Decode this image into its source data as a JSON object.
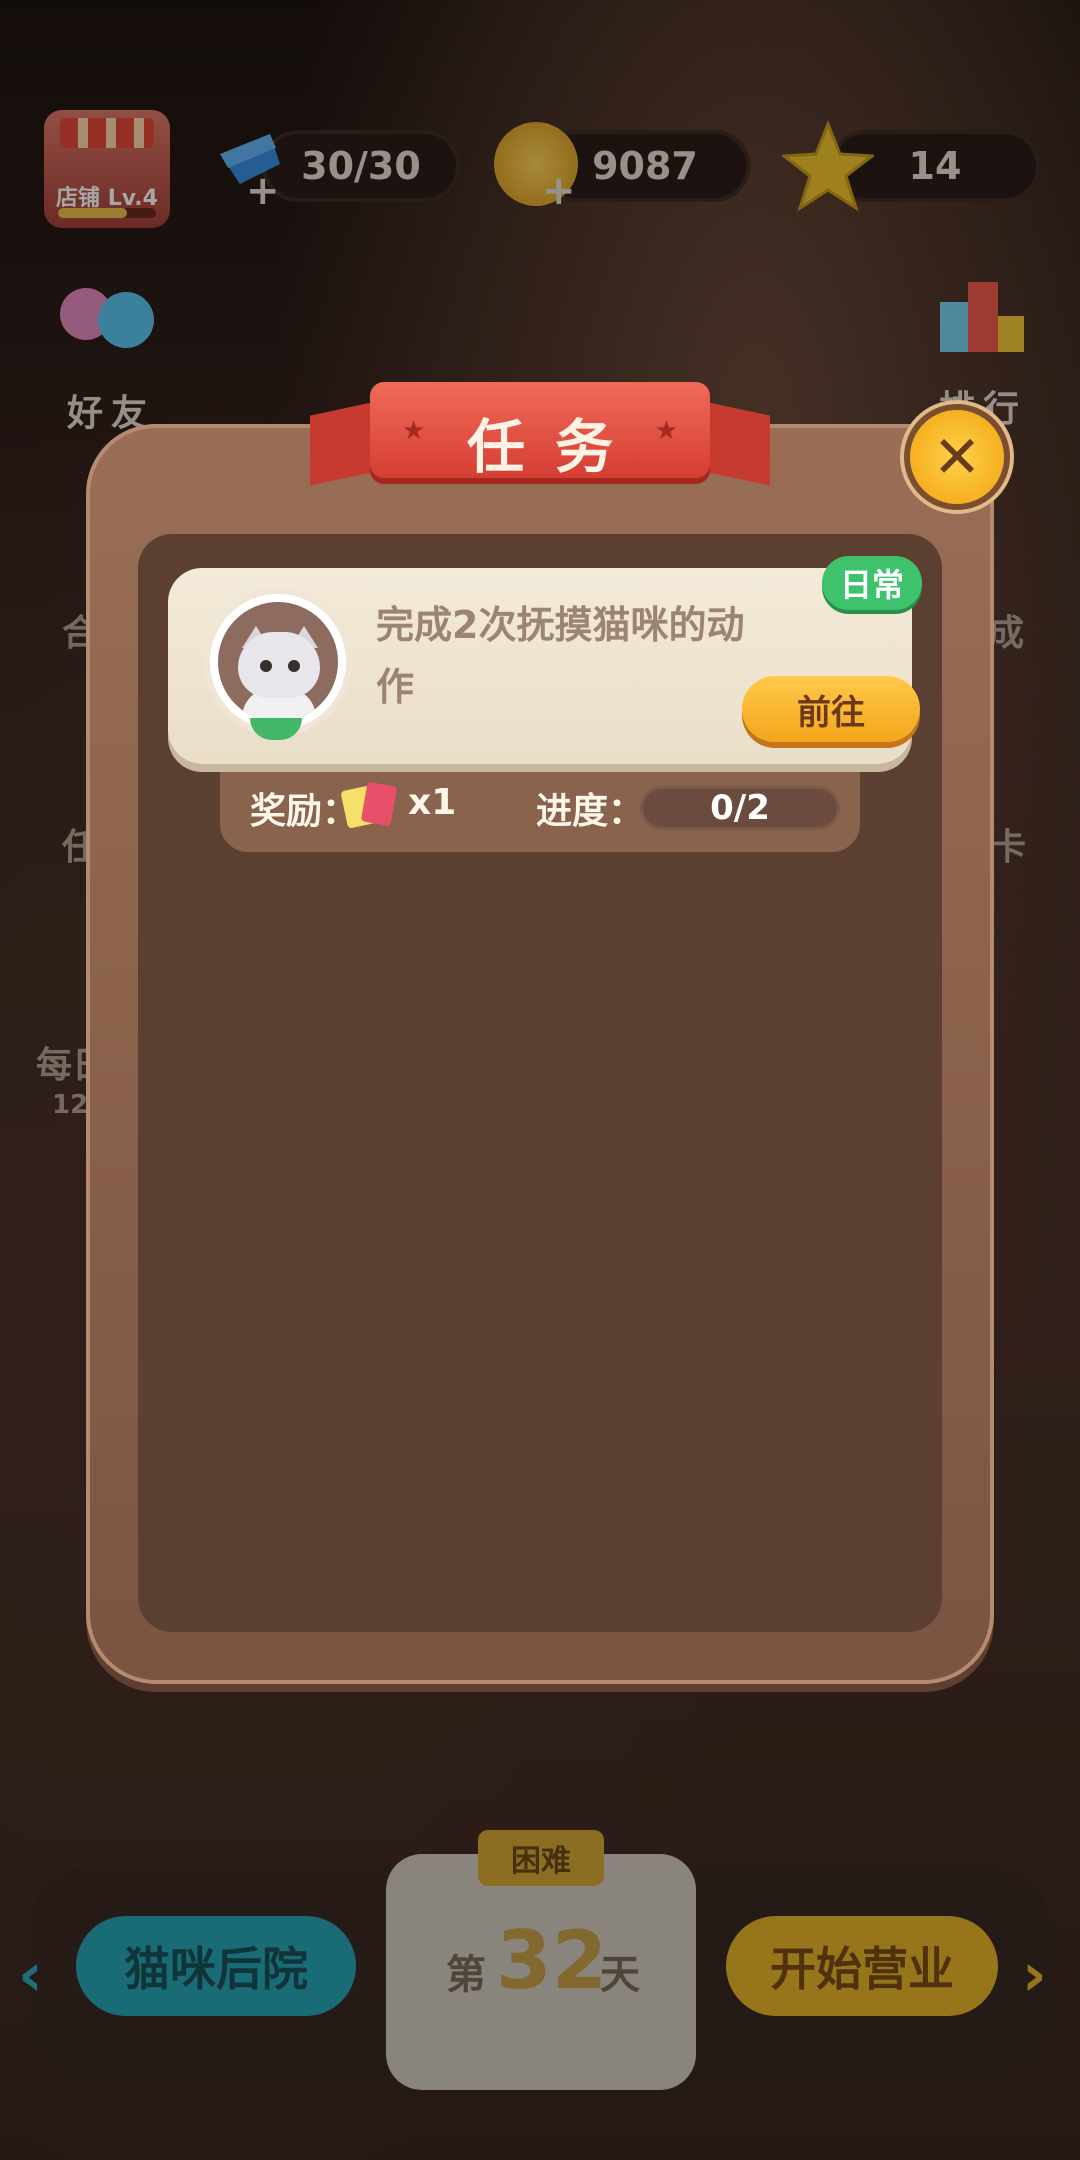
{
  "top_bar": {
    "shop_label": "店铺 Lv.4",
    "energy": "30/30",
    "coins": "9087",
    "stars": "14"
  },
  "side_menu": {
    "friends": "好友",
    "ranking": "排行",
    "left_cut_1": "合",
    "left_cut_2": "任",
    "left_cut_3": "每日",
    "left_cut_3_sub": "12",
    "right_cut_1": "成",
    "right_cut_2": "卡"
  },
  "modal": {
    "title": "任务",
    "task": {
      "description": "完成2次抚摸猫咪的动作",
      "tag": "日常",
      "go_button": "前往",
      "reward_label": "奖励：",
      "reward_count": "x1",
      "progress_label": "进度：",
      "progress": "0/2",
      "progress_fraction": 0
    }
  },
  "bottom": {
    "backyard_button": "猫咪后院",
    "difficulty": "困难",
    "day_prefix": "第",
    "day_number": "32",
    "day_suffix": "天",
    "start_button": "开始营业"
  },
  "colors": {
    "ribbon": "#e2493c",
    "tag_green": "#3ec36c",
    "go_orange": "#f6b02a",
    "close_yellow": "#fbbf2a"
  },
  "icons": [
    "shop-icon",
    "energy-icon",
    "coin-icon",
    "star-icon",
    "friends-icon",
    "ranking-icon",
    "close-icon",
    "cat-avatar",
    "reward-card-icon"
  ]
}
